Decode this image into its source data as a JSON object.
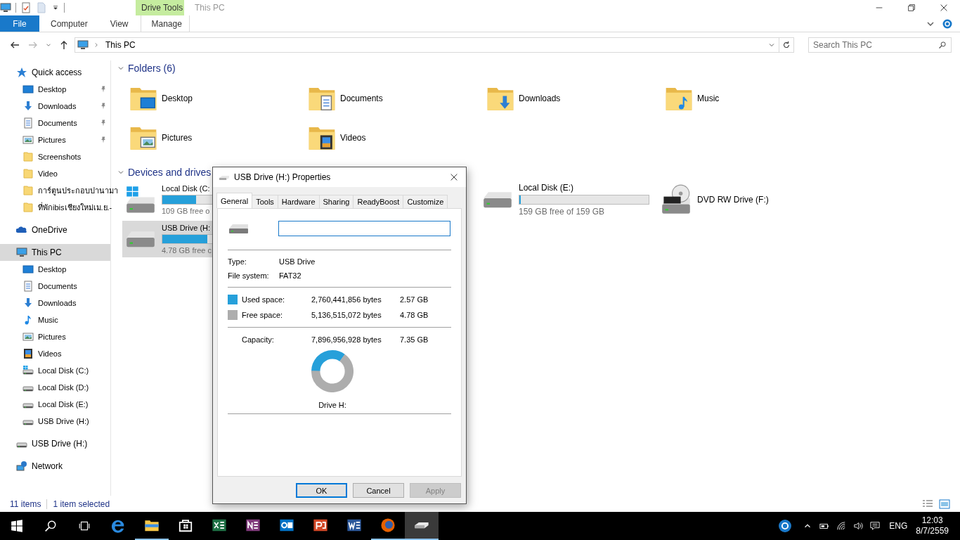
{
  "window": {
    "title": "This PC"
  },
  "ribbon": {
    "context_header": "Drive Tools",
    "tabs": [
      {
        "label": "File",
        "kind": "file",
        "selected": false
      },
      {
        "label": "Computer",
        "kind": "tab",
        "selected": false
      },
      {
        "label": "View",
        "kind": "tab",
        "selected": false
      },
      {
        "label": "Manage",
        "kind": "context",
        "selected": false
      }
    ]
  },
  "address_bar": {
    "path": "This PC",
    "search_placeholder": "Search This PC"
  },
  "sidebar": {
    "items": [
      {
        "label": "Quick access",
        "kind": "star",
        "selected": false,
        "children": [
          {
            "label": "Desktop",
            "kind": "desktop",
            "pinned": true,
            "selected": false
          },
          {
            "label": "Downloads",
            "kind": "downloads",
            "pinned": true,
            "selected": false
          },
          {
            "label": "Documents",
            "kind": "documents",
            "pinned": true,
            "selected": false
          },
          {
            "label": "Pictures",
            "kind": "pictures",
            "pinned": true,
            "selected": false
          },
          {
            "label": "Screenshots",
            "kind": "folder",
            "pinned": false,
            "selected": false
          },
          {
            "label": "Video",
            "kind": "folder",
            "pinned": false,
            "selected": false
          },
          {
            "label": "การ์ตูนประกอบปานามา",
            "kind": "folder",
            "pinned": false,
            "selected": false
          },
          {
            "label": "ที่พักibisเชียงใหม่เม.ย.-",
            "kind": "folder",
            "pinned": false,
            "selected": false
          }
        ]
      },
      {
        "label": "OneDrive",
        "kind": "onedrive",
        "selected": false
      },
      {
        "label": "This PC",
        "kind": "pc",
        "selected": true,
        "children": [
          {
            "label": "Desktop",
            "kind": "desktop",
            "selected": false
          },
          {
            "label": "Documents",
            "kind": "documents",
            "selected": false
          },
          {
            "label": "Downloads",
            "kind": "downloads",
            "selected": false
          },
          {
            "label": "Music",
            "kind": "music",
            "selected": false
          },
          {
            "label": "Pictures",
            "kind": "pictures",
            "selected": false
          },
          {
            "label": "Videos",
            "kind": "videos",
            "selected": false
          },
          {
            "label": "Local Disk (C:)",
            "kind": "windows-disk",
            "selected": false
          },
          {
            "label": "Local Disk (D:)",
            "kind": "disk",
            "selected": false
          },
          {
            "label": "Local Disk (E:)",
            "kind": "disk",
            "selected": false
          },
          {
            "label": "USB Drive (H:)",
            "kind": "disk",
            "selected": false
          }
        ]
      },
      {
        "label": "USB Drive (H:)",
        "kind": "disk",
        "selected": false
      },
      {
        "label": "Network",
        "kind": "network",
        "selected": false
      }
    ]
  },
  "folders": {
    "title": "Folders (6)",
    "items": [
      {
        "name": "Desktop",
        "kind": "desktop"
      },
      {
        "name": "Documents",
        "kind": "documents"
      },
      {
        "name": "Downloads",
        "kind": "downloads"
      },
      {
        "name": "Music",
        "kind": "music"
      },
      {
        "name": "Pictures",
        "kind": "pictures"
      },
      {
        "name": "Videos",
        "kind": "videos"
      }
    ]
  },
  "devices": {
    "title": "Devices and drives",
    "items": [
      {
        "name": "Local Disk (C:",
        "kind": "windows-disk",
        "level": 0.26,
        "detail": "109 GB free o",
        "selected": false
      },
      {
        "name": "Local Disk (E:)",
        "kind": "disk",
        "level": 0.01,
        "detail": "159 GB free of 159 GB",
        "selected": false
      },
      {
        "name": "DVD RW Drive (F:)",
        "kind": "dvd",
        "selected": false
      },
      {
        "name": "USB Drive (H:",
        "kind": "disk",
        "level": 0.35,
        "detail": "4.78 GB free c",
        "selected": true
      }
    ]
  },
  "status_bar": {
    "count": "11 items",
    "selection": "1 item selected"
  },
  "dialog": {
    "title": "USB Drive (H:) Properties",
    "tabs": [
      {
        "label": "General",
        "selected": true
      },
      {
        "label": "Tools",
        "selected": false
      },
      {
        "label": "Hardware",
        "selected": false
      },
      {
        "label": "Sharing",
        "selected": false
      },
      {
        "label": "ReadyBoost",
        "selected": false
      },
      {
        "label": "Customize",
        "selected": false
      }
    ],
    "properties": [
      {
        "label": "Type:",
        "value": "USB Drive"
      },
      {
        "label": "File system:",
        "value": "FAT32"
      }
    ],
    "space": [
      {
        "label": "Used space:",
        "bytes": "2,760,441,856 bytes",
        "size": "2.57 GB",
        "color": "#26a0da"
      },
      {
        "label": "Free space:",
        "bytes": "5,136,515,072 bytes",
        "size": "4.78 GB",
        "color": "#adadad"
      }
    ],
    "capacity": {
      "label": "Capacity:",
      "bytes": "7,896,956,928 bytes",
      "size": "7.35 GB"
    },
    "drive_label": "Drive H:",
    "buttons": [
      {
        "label": "OK",
        "default": true,
        "disabled": false
      },
      {
        "label": "Cancel",
        "default": false,
        "disabled": false
      },
      {
        "label": "Apply",
        "default": false,
        "disabled": true
      }
    ]
  },
  "taskbar": {
    "apps": [
      {
        "kind": "edge",
        "running": false,
        "selected": false
      },
      {
        "kind": "explorer",
        "running": true,
        "selected": false
      },
      {
        "kind": "store",
        "running": false,
        "selected": false
      },
      {
        "kind": "excel",
        "running": false,
        "selected": false
      },
      {
        "kind": "onenote",
        "running": false,
        "selected": false
      },
      {
        "kind": "outlook",
        "running": false,
        "selected": false
      },
      {
        "kind": "powerpoint",
        "running": false,
        "selected": false
      },
      {
        "kind": "word",
        "running": false,
        "selected": false
      },
      {
        "kind": "firefox",
        "running": true,
        "selected": false
      },
      {
        "kind": "drive",
        "running": true,
        "selected": true
      }
    ],
    "language": "ENG",
    "time": "12:03",
    "date": "8/7/2559"
  }
}
